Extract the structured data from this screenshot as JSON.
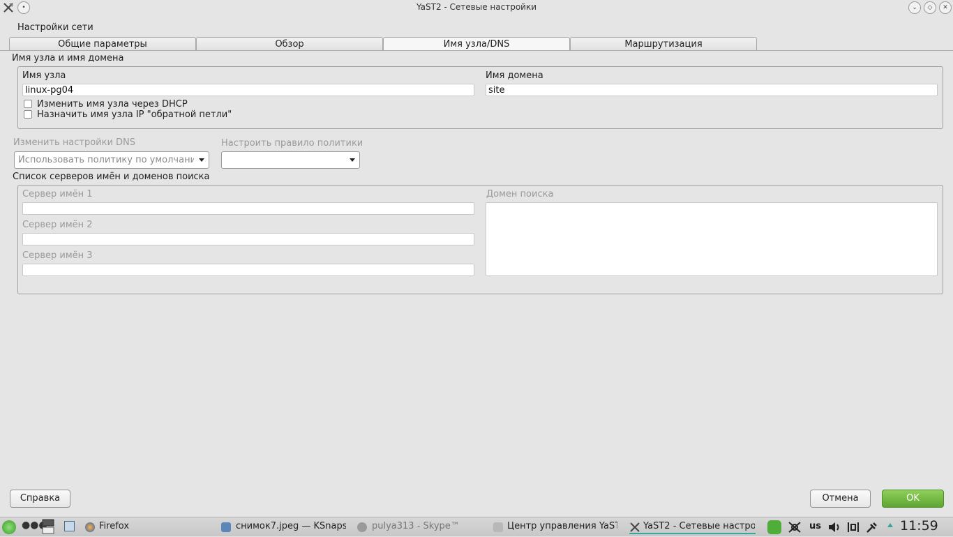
{
  "window": {
    "title": "YaST2 - Сетевые настройки"
  },
  "section_title": "Настройки сети",
  "tabs": [
    {
      "label": "Общие параметры"
    },
    {
      "label": "Обзор"
    },
    {
      "label": "Имя узла/DNS"
    },
    {
      "label": "Маршрутизация"
    }
  ],
  "hostname_group": {
    "title": "Имя узла и имя домена",
    "hostname_label": "Имя узла",
    "hostname_value": "linux-pg04",
    "domain_label": "Имя домена",
    "domain_value": "site",
    "dhcp_checkbox": "Изменить имя узла через DHCP",
    "loopback_checkbox": "Назначить имя узла IP \"обратной петли\""
  },
  "dns": {
    "modify_label": "Изменить настройки DNS",
    "modify_value": "Использовать политику по умолчанию",
    "policy_label": "Настроить правило политики",
    "policy_value": ""
  },
  "servers_group": {
    "title": "Список серверов имён и доменов поиска",
    "ns1_label": "Сервер имён 1",
    "ns2_label": "Сервер имён 2",
    "ns3_label": "Сервер имён 3",
    "search_label": "Домен поиска"
  },
  "buttons": {
    "help": "Справка",
    "cancel": "Отмена",
    "ok": "OK"
  },
  "taskbar": {
    "items": [
      {
        "label": "Firefox"
      },
      {
        "label": "снимок7.jpeg — KSnapsh"
      },
      {
        "label": "pulya313 - Skype™"
      },
      {
        "label": "Центр управления YaST"
      },
      {
        "label": "YaST2 - Сетевые настро"
      }
    ],
    "keyboard_layout": "us",
    "clock": "11:59"
  },
  "colors": {
    "ok_button": "#6cb33f",
    "window_bg": "#e5e5e5"
  }
}
